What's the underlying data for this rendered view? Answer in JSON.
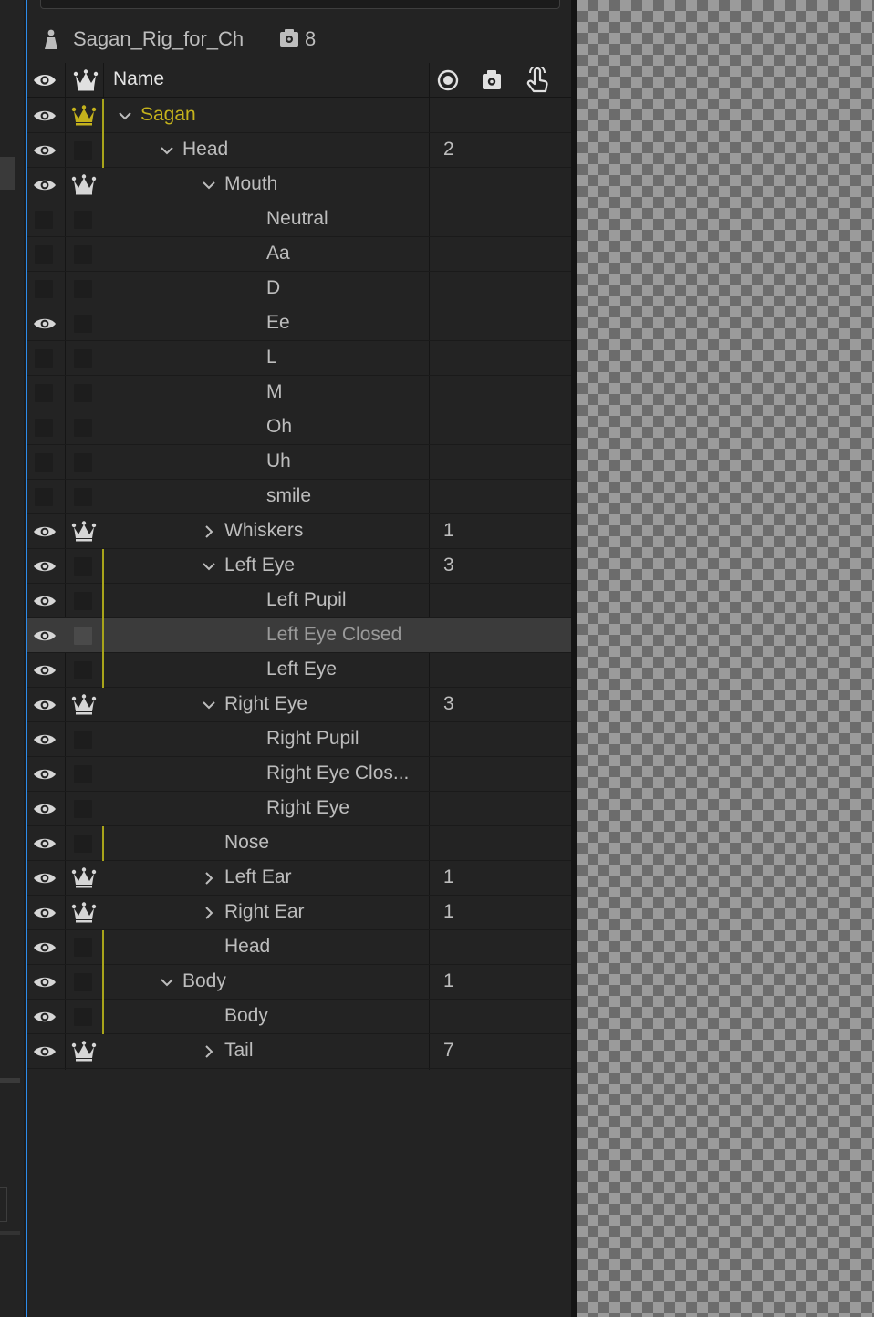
{
  "puppet": {
    "name": "Sagan_Rig_for_Ch",
    "behavior_count": "8"
  },
  "columns": {
    "name": "Name"
  },
  "colors": {
    "accent_line": "#2d8ceb",
    "root_label": "#c4b21c",
    "yellow_line": "#a8a41a",
    "selected_row": "#3b3b3b"
  },
  "rows": [
    {
      "label": "Sagan",
      "count": "",
      "depth": 0,
      "expander": "down",
      "visible": true,
      "crown": "gold",
      "yellow_line": true,
      "root": true
    },
    {
      "label": "Head",
      "count": "2",
      "depth": 1,
      "expander": "down",
      "visible": true,
      "crown": "none",
      "yellow_line": true
    },
    {
      "label": "Mouth",
      "count": "",
      "depth": 2,
      "expander": "down",
      "visible": true,
      "crown": "white",
      "yellow_line": false
    },
    {
      "label": "Neutral",
      "count": "",
      "depth": 3,
      "expander": "none",
      "visible": false,
      "crown": "none",
      "yellow_line": false
    },
    {
      "label": "Aa",
      "count": "",
      "depth": 3,
      "expander": "none",
      "visible": false,
      "crown": "none",
      "yellow_line": false
    },
    {
      "label": "D",
      "count": "",
      "depth": 3,
      "expander": "none",
      "visible": false,
      "crown": "none",
      "yellow_line": false
    },
    {
      "label": "Ee",
      "count": "",
      "depth": 3,
      "expander": "none",
      "visible": true,
      "crown": "none",
      "yellow_line": false
    },
    {
      "label": "L",
      "count": "",
      "depth": 3,
      "expander": "none",
      "visible": false,
      "crown": "none",
      "yellow_line": false
    },
    {
      "label": "M",
      "count": "",
      "depth": 3,
      "expander": "none",
      "visible": false,
      "crown": "none",
      "yellow_line": false
    },
    {
      "label": "Oh",
      "count": "",
      "depth": 3,
      "expander": "none",
      "visible": false,
      "crown": "none",
      "yellow_line": false
    },
    {
      "label": "Uh",
      "count": "",
      "depth": 3,
      "expander": "none",
      "visible": false,
      "crown": "none",
      "yellow_line": false
    },
    {
      "label": "smile",
      "count": "",
      "depth": 3,
      "expander": "none",
      "visible": false,
      "crown": "none",
      "yellow_line": false
    },
    {
      "label": "Whiskers",
      "count": "1",
      "depth": 2,
      "expander": "right",
      "visible": true,
      "crown": "white",
      "yellow_line": false
    },
    {
      "label": "Left Eye",
      "count": "3",
      "depth": 2,
      "expander": "down",
      "visible": true,
      "crown": "none",
      "yellow_line": true
    },
    {
      "label": "Left Pupil",
      "count": "",
      "depth": 3,
      "expander": "none",
      "visible": true,
      "crown": "none",
      "yellow_line": true
    },
    {
      "label": "Left Eye Closed",
      "count": "",
      "depth": 3,
      "expander": "none",
      "visible": true,
      "crown": "none",
      "yellow_line": true,
      "selected": true
    },
    {
      "label": "Left Eye",
      "count": "",
      "depth": 3,
      "expander": "none",
      "visible": true,
      "crown": "none",
      "yellow_line": true
    },
    {
      "label": "Right Eye",
      "count": "3",
      "depth": 2,
      "expander": "down",
      "visible": true,
      "crown": "white",
      "yellow_line": false
    },
    {
      "label": "Right Pupil",
      "count": "",
      "depth": 3,
      "expander": "none",
      "visible": true,
      "crown": "none",
      "yellow_line": false
    },
    {
      "label": "Right Eye Clos...",
      "count": "",
      "depth": 3,
      "expander": "none",
      "visible": true,
      "crown": "none",
      "yellow_line": false
    },
    {
      "label": "Right Eye",
      "count": "",
      "depth": 3,
      "expander": "none",
      "visible": true,
      "crown": "none",
      "yellow_line": false
    },
    {
      "label": "Nose",
      "count": "",
      "depth": 2,
      "expander": "none",
      "visible": true,
      "crown": "none",
      "yellow_line": true
    },
    {
      "label": "Left Ear",
      "count": "1",
      "depth": 2,
      "expander": "right",
      "visible": true,
      "crown": "white",
      "yellow_line": false
    },
    {
      "label": "Right Ear",
      "count": "1",
      "depth": 2,
      "expander": "right",
      "visible": true,
      "crown": "white",
      "yellow_line": false
    },
    {
      "label": "Head",
      "count": "",
      "depth": 2,
      "expander": "none",
      "visible": true,
      "crown": "none",
      "yellow_line": true
    },
    {
      "label": "Body",
      "count": "1",
      "depth": 1,
      "expander": "down",
      "visible": true,
      "crown": "none",
      "yellow_line": true
    },
    {
      "label": "Body",
      "count": "",
      "depth": 2,
      "expander": "none",
      "visible": true,
      "crown": "none",
      "yellow_line": true
    },
    {
      "label": "Tail",
      "count": "7",
      "depth": 2,
      "expander": "right",
      "visible": true,
      "crown": "white",
      "yellow_line": false
    }
  ]
}
